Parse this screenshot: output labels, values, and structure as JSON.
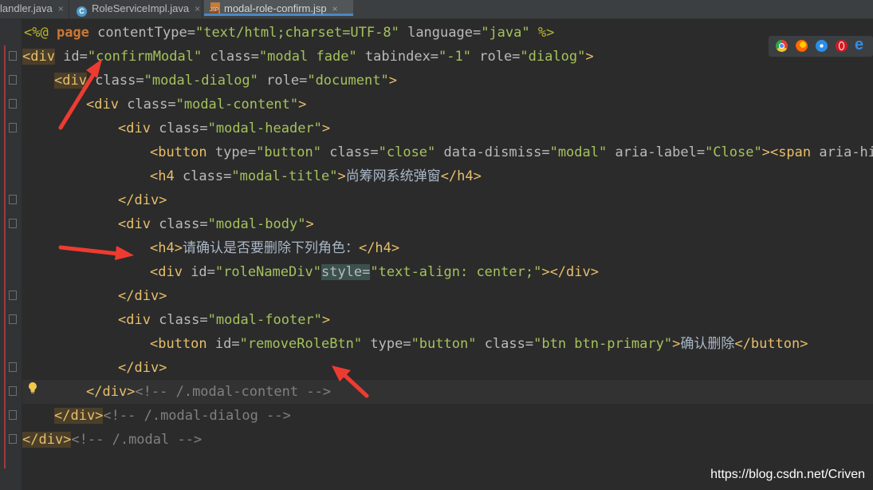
{
  "tabs": [
    {
      "label": "landler.java",
      "close": "×"
    },
    {
      "label": "RoleServiceImpl.java",
      "close": "×",
      "icon": "C"
    },
    {
      "label": "modal-role-confirm.jsp",
      "close": "×",
      "active": true
    }
  ],
  "code": {
    "l1": {
      "open": "<%@ ",
      "kw": "page",
      "a1": " contentType=",
      "v1": "\"text/html;charset=UTF-8\"",
      "a2": " language=",
      "v2": "\"java\"",
      "close": " %>"
    },
    "l2": {
      "t1": "<div",
      "a1": " id=",
      "v1": "\"confirmModal\"",
      "a2": " class=",
      "v2": "\"modal fade\"",
      "a3": " tabindex=",
      "v3": "\"-1\"",
      "a4": " role=",
      "v4": "\"dialog\"",
      "t2": ">"
    },
    "l3": {
      "t1": "<div",
      "a1": " class=",
      "v1": "\"modal-dialog\"",
      "a2": " role=",
      "v2": "\"document\"",
      "t2": ">"
    },
    "l4": {
      "t1": "<div",
      "a1": " class=",
      "v1": "\"modal-content\"",
      "t2": ">"
    },
    "l5": {
      "t1": "<div",
      "a1": " class=",
      "v1": "\"modal-header\"",
      "t2": ">"
    },
    "l6": {
      "t1": "<button",
      "a1": " type=",
      "v1": "\"button\"",
      "a2": " class=",
      "v2": "\"close\"",
      "a3": " data-dismiss=",
      "v3": "\"modal\"",
      "a4": " aria-label=",
      "v4": "\"Close\"",
      "t2": "><span",
      "a5": " aria-hidd"
    },
    "l7": {
      "t1": "<h4",
      "a1": " class=",
      "v1": "\"modal-title\"",
      "t2": ">",
      "tx": "尚筹网系统弹窗",
      "t3": "</h4>"
    },
    "l8": {
      "t1": "</div>"
    },
    "l9": {
      "t1": "<div",
      "a1": " class=",
      "v1": "\"modal-body\"",
      "t2": ">"
    },
    "l10": {
      "t1": "<h4>",
      "tx": "请确认是否要删除下列角色：",
      "t2": "</h4>"
    },
    "l11": {
      "t1": "<div",
      "a1": " id=",
      "v1": "\"roleNameDiv\"",
      "a2": "style=",
      "v2": "\"text-align: center;\"",
      "t2": "></div>"
    },
    "l12": {
      "t1": "</div>"
    },
    "l13": {
      "t1": "<div",
      "a1": " class=",
      "v1": "\"modal-footer\"",
      "t2": ">"
    },
    "l14": {
      "t1": "<button",
      "a1": " id=",
      "v1": "\"removeRoleBtn\"",
      "a2": " type=",
      "v2": "\"button\"",
      "a3": " class=",
      "v3": "\"btn btn-primary\"",
      "t2": ">",
      "tx": "确认删除",
      "t3": "</button>"
    },
    "l15": {
      "t1": "</div>"
    },
    "l16": {
      "t1": "</div>",
      "cm": "<!-- /.modal-content -->"
    },
    "l17": {
      "t1": "</div>",
      "cm": "<!-- /.modal-dialog -->"
    },
    "l18": {
      "t1": "</div>",
      "cm": "<!-- /.modal -->"
    }
  },
  "browser_icons": [
    "chrome-icon",
    "firefox-icon",
    "safari-icon",
    "opera-icon",
    "edge-icon"
  ],
  "watermark": "https://blog.csdn.net/Criven",
  "colors": {
    "tag": "#e8bf6a",
    "attr": "#bababa",
    "value": "#a5c25c",
    "comment": "#808080",
    "arrow": "#ee3b32"
  }
}
